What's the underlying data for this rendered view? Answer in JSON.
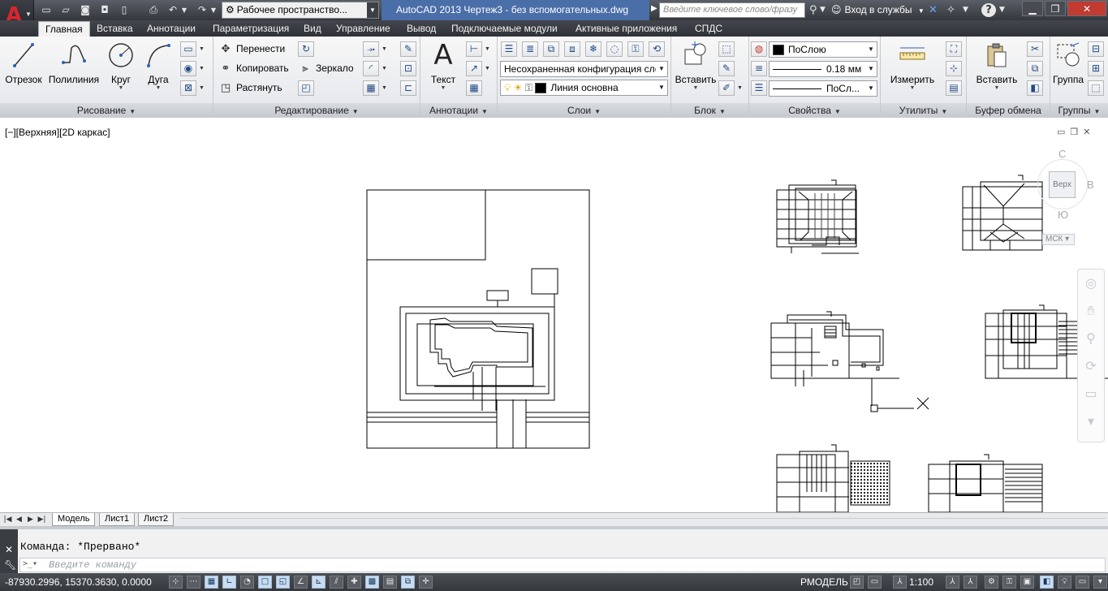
{
  "title_bar": {
    "workspace": "Рабочее пространство...",
    "document_title": "AutoCAD 2013    Чертеж3 - без вспомогательных.dwg",
    "search_placeholder": "Введите ключевое слово/фразу",
    "login_label": "Вход в службы",
    "help_label": "?"
  },
  "ribbon_tabs": [
    {
      "label": "Главная",
      "active": true
    },
    {
      "label": "Вставка"
    },
    {
      "label": "Аннотации"
    },
    {
      "label": "Параметризация"
    },
    {
      "label": "Вид"
    },
    {
      "label": "Управление"
    },
    {
      "label": "Вывод"
    },
    {
      "label": "Подключаемые модули"
    },
    {
      "label": "Активные приложения"
    },
    {
      "label": "СПДС"
    }
  ],
  "ribbon": {
    "draw": {
      "title": "Рисование",
      "line": "Отрезок",
      "polyline": "Полилиния",
      "circle": "Круг",
      "arc": "Дуга"
    },
    "modify": {
      "title": "Редактирование",
      "move": "Перенести",
      "copy": "Копировать",
      "stretch": "Растянуть",
      "mirror": "Зеркало"
    },
    "annotation": {
      "title": "Аннотации",
      "text": "Текст",
      "glyph": "A"
    },
    "layers": {
      "title": "Слои",
      "layer_state": "Несохраненная конфигурация сло",
      "current_layer": "Линия основна"
    },
    "block": {
      "title": "Блок",
      "insert": "Вставить"
    },
    "properties": {
      "title": "Свойства",
      "color": "ПоСлою",
      "lineweight": "0.18 мм",
      "linetype": "ПоСл..."
    },
    "utilities": {
      "title": "Утилиты",
      "measure": "Измерить"
    },
    "clipboard": {
      "title": "Буфер обмена",
      "paste": "Вставить"
    },
    "groups": {
      "title": "Группы",
      "group": "Группа"
    }
  },
  "viewport": {
    "label": "[−][Верхняя][2D каркас]",
    "viewcube": {
      "north": "С",
      "east": "В",
      "south": "Ю",
      "face": "Верх",
      "ucs": "МСК"
    }
  },
  "layout_tabs": [
    {
      "label": "Модель",
      "active": true
    },
    {
      "label": "Лист1"
    },
    {
      "label": "Лист2"
    }
  ],
  "command_line": {
    "history": "Команда: *Прервано*",
    "placeholder": "Введите команду"
  },
  "status_bar": {
    "coordinates": "-87930.2996, 15370.3630, 0.0000",
    "model_label": "РМОДЕЛЬ",
    "scale_label": "1:100"
  },
  "colors": {
    "accent": "#4a6ea8",
    "title_bar_bg": "#3d4046",
    "logo_red": "#d8262e"
  }
}
